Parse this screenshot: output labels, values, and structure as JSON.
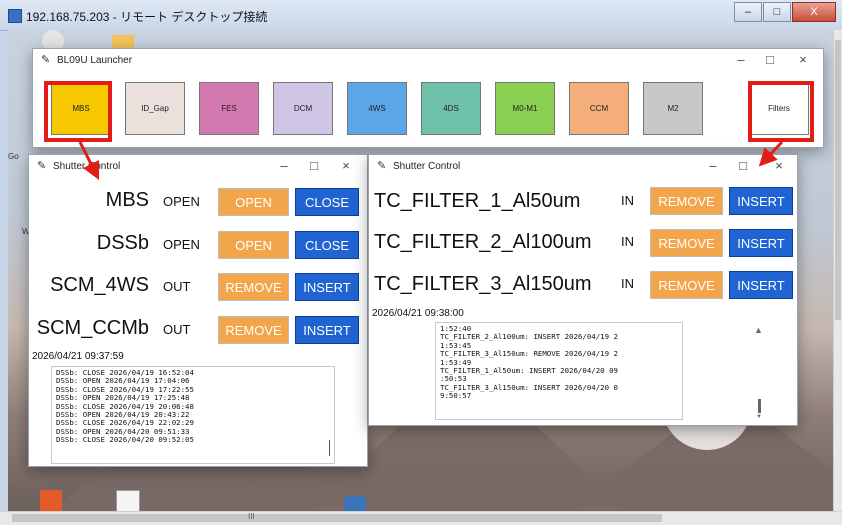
{
  "rdp": {
    "title": "192.168.75.203 - リモート デスクトップ接続",
    "controls": [
      "–",
      "□",
      "X"
    ],
    "hscroll_label": "III"
  },
  "desktop": {
    "icon_labels": [
      "Go",
      "W"
    ]
  },
  "launcher": {
    "title": "BL09U Launcher",
    "controls": [
      "–",
      "□",
      "×"
    ],
    "buttons": [
      {
        "label": "MBS",
        "color": "#f5c800"
      },
      {
        "label": "ID_Gap",
        "color": "#ece0dc"
      },
      {
        "label": "FES",
        "color": "#d27ab0"
      },
      {
        "label": "DCM",
        "color": "#cfc6e6"
      },
      {
        "label": "4WS",
        "color": "#5aa6e6"
      },
      {
        "label": "4DS",
        "color": "#6fc0a8"
      },
      {
        "label": "M0-M1",
        "color": "#88cf52"
      },
      {
        "label": "CCM",
        "color": "#f4ae7c"
      },
      {
        "label": "M2",
        "color": "#c8c8c8"
      },
      {
        "label": "Filters",
        "color": "#ffffff"
      }
    ]
  },
  "shutter_left": {
    "title": "Shutter Control",
    "controls": [
      "–",
      "□",
      "×"
    ],
    "rows": [
      {
        "name": "MBS",
        "state": "OPEN",
        "btn1": "OPEN",
        "btn2": "CLOSE"
      },
      {
        "name": "DSSb",
        "state": "OPEN",
        "btn1": "OPEN",
        "btn2": "CLOSE"
      },
      {
        "name": "SCM_4WS",
        "state": "OUT",
        "btn1": "REMOVE",
        "btn2": "INSERT"
      },
      {
        "name": "SCM_CCMb",
        "state": "OUT",
        "btn1": "REMOVE",
        "btn2": "INSERT"
      }
    ],
    "timestamp": "2026/04/21 09:37:59",
    "log": [
      "DSSb: CLOSE 2026/04/19 16:52:04",
      "DSSb: OPEN 2026/04/19 17:04:06",
      "DSSb: CLOSE 2026/04/19 17:22:55",
      "DSSb: OPEN 2026/04/19 17:25:48",
      "DSSb: CLOSE 2026/04/19 20:06:48",
      "DSSb: OPEN 2026/04/19 20:43:22",
      "DSSb: CLOSE 2026/04/19 22:02:29",
      "DSSb: OPEN 2026/04/20 09:51:33",
      "DSSb: CLOSE 2026/04/20 09:52:05"
    ]
  },
  "shutter_right": {
    "title": "Shutter Control",
    "controls": [
      "–",
      "□",
      "×"
    ],
    "rows": [
      {
        "name": "TC_FILTER_1_Al50um",
        "state": "IN",
        "btn1": "REMOVE",
        "btn2": "INSERT"
      },
      {
        "name": "TC_FILTER_2_Al100um",
        "state": "IN",
        "btn1": "REMOVE",
        "btn2": "INSERT"
      },
      {
        "name": "TC_FILTER_3_Al150um",
        "state": "IN",
        "btn1": "REMOVE",
        "btn2": "INSERT"
      }
    ],
    "timestamp": "2026/04/21 09:38:00",
    "log": [
      "1:52:40",
      "TC_FILTER_2_Al100um: INSERT 2026/04/19 2",
      "1:53:45",
      "TC_FILTER_3_Al150um: REMOVE 2026/04/19 2",
      "1:53:49",
      "TC_FILTER_1_Al50um: INSERT 2026/04/20 09",
      ":50:53",
      "TC_FILTER_3_Al150um: INSERT 2026/04/20 0",
      "9:50:57"
    ]
  },
  "colors": {
    "highlight": "#e11d16",
    "open_button": "#f3a54b",
    "close_button": "#1f64d2"
  }
}
